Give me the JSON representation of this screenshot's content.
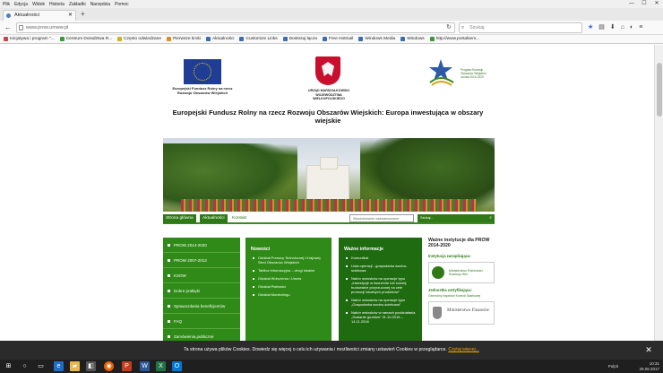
{
  "browser": {
    "menu": [
      "Plik",
      "Edycja",
      "Widok",
      "Historia",
      "Zakładki",
      "Narzędzia",
      "Pomoc"
    ],
    "tab_title": "Aktualności",
    "new_tab": "+",
    "url": "www.prow.umww.pl",
    "search_placeholder": "Szukaj",
    "bookmarks": [
      {
        "label": "Inicjatywa i program \"...",
        "color": "r"
      },
      {
        "label": "Centrum Doradztwa R...",
        "color": "g"
      },
      {
        "label": "Często odwiedzane",
        "color": "y"
      },
      {
        "label": "Pierwsze kroki",
        "color": "o"
      },
      {
        "label": "Aktualności",
        "color": "b"
      },
      {
        "label": "Customize Links",
        "color": "b"
      },
      {
        "label": "Dostosuj łącza",
        "color": "b"
      },
      {
        "label": "Free Hotmail",
        "color": "b"
      },
      {
        "label": "Windows Media",
        "color": "b"
      },
      {
        "label": "Windows",
        "color": "b"
      },
      {
        "label": "http://www.portalsem...",
        "color": "g"
      }
    ]
  },
  "logos": {
    "eu_caption": "Europejski Fundusz Rolny na rzecz Rozwoju Obszarów Wiejskich",
    "wlkp_caption": "URZĄD MARSZAŁKOWSKI WOJEWÓDZTWA WIELKOPOLSKIEGO",
    "prow_caption": "Program Rozwoju Obszarów Wiejskich na lata 2014-2020"
  },
  "headline": "Europejski Fundusz Rolny na rzecz Rozwoju Obszarów Wiejskich: Europa inwestująca w obszary wiejskie",
  "subnav": {
    "home": "Strona główna",
    "news": "Aktualności",
    "contact": "Kontakt",
    "adv_search": "Wyszukiwanie zaawansowane",
    "search": "Szukaj..."
  },
  "leftnav": [
    "PROW 2014-2020",
    "PROW 2007-2013",
    "KSOW",
    "Dobre praktyki",
    "Sprawozdania beneficjentów",
    "FAQ",
    "Zamówienia publiczne"
  ],
  "col1": {
    "title": "Nowości",
    "items": [
      "Oddział Pomocy Technicznej i Krajowej Sieci Obszarów Wiejskich",
      "Tablica informacyjna – drogi lokalne",
      "Oddział Wdrożenia i Umów",
      "Oddział Płatności",
      "Oddział Monitoringu"
    ]
  },
  "col2": {
    "title": "Ważne informacje",
    "items": [
      "Komunikat",
      "Lista operacji - gospodarka wodno-ściekowa",
      "Nabór wniosków na operacje typu „Inwestycje w tworzenie lub rozwój budowanie przyrzuconej na cele promocji lokalnych produktów”",
      "Nabór wniosków na operacje typu „Gospodarka wodno-ściekowa”",
      "Nabór wniosków w ramach poddziałania „Scalanie gruntów” 31.10.2016 – 14.11.2016"
    ]
  },
  "right": {
    "title": "Ważne instytucje dla PROW 2014-2020",
    "inst_manage": "Instytucja zarządzająca:",
    "ministry": "Ministerstwo Rolnictwa i Rozwoju Wsi",
    "cert": "Jednostka certyfikująca:",
    "cert_detail": "Generalny Inspektor Kontroli Skarbowej",
    "finance": "Ministerstwo Finansów"
  },
  "cookie": {
    "text": "Ta strona używa plików Cookies. Dowiedz się więcej o celu ich używania i możliwości zmiany ustawień Cookies w przeglądarce.",
    "link": "Czytaj więcej...",
    "close": "✕"
  },
  "taskbar": {
    "time": "10:31",
    "date": "29.06.2017",
    "desktop": "Pulpit"
  }
}
